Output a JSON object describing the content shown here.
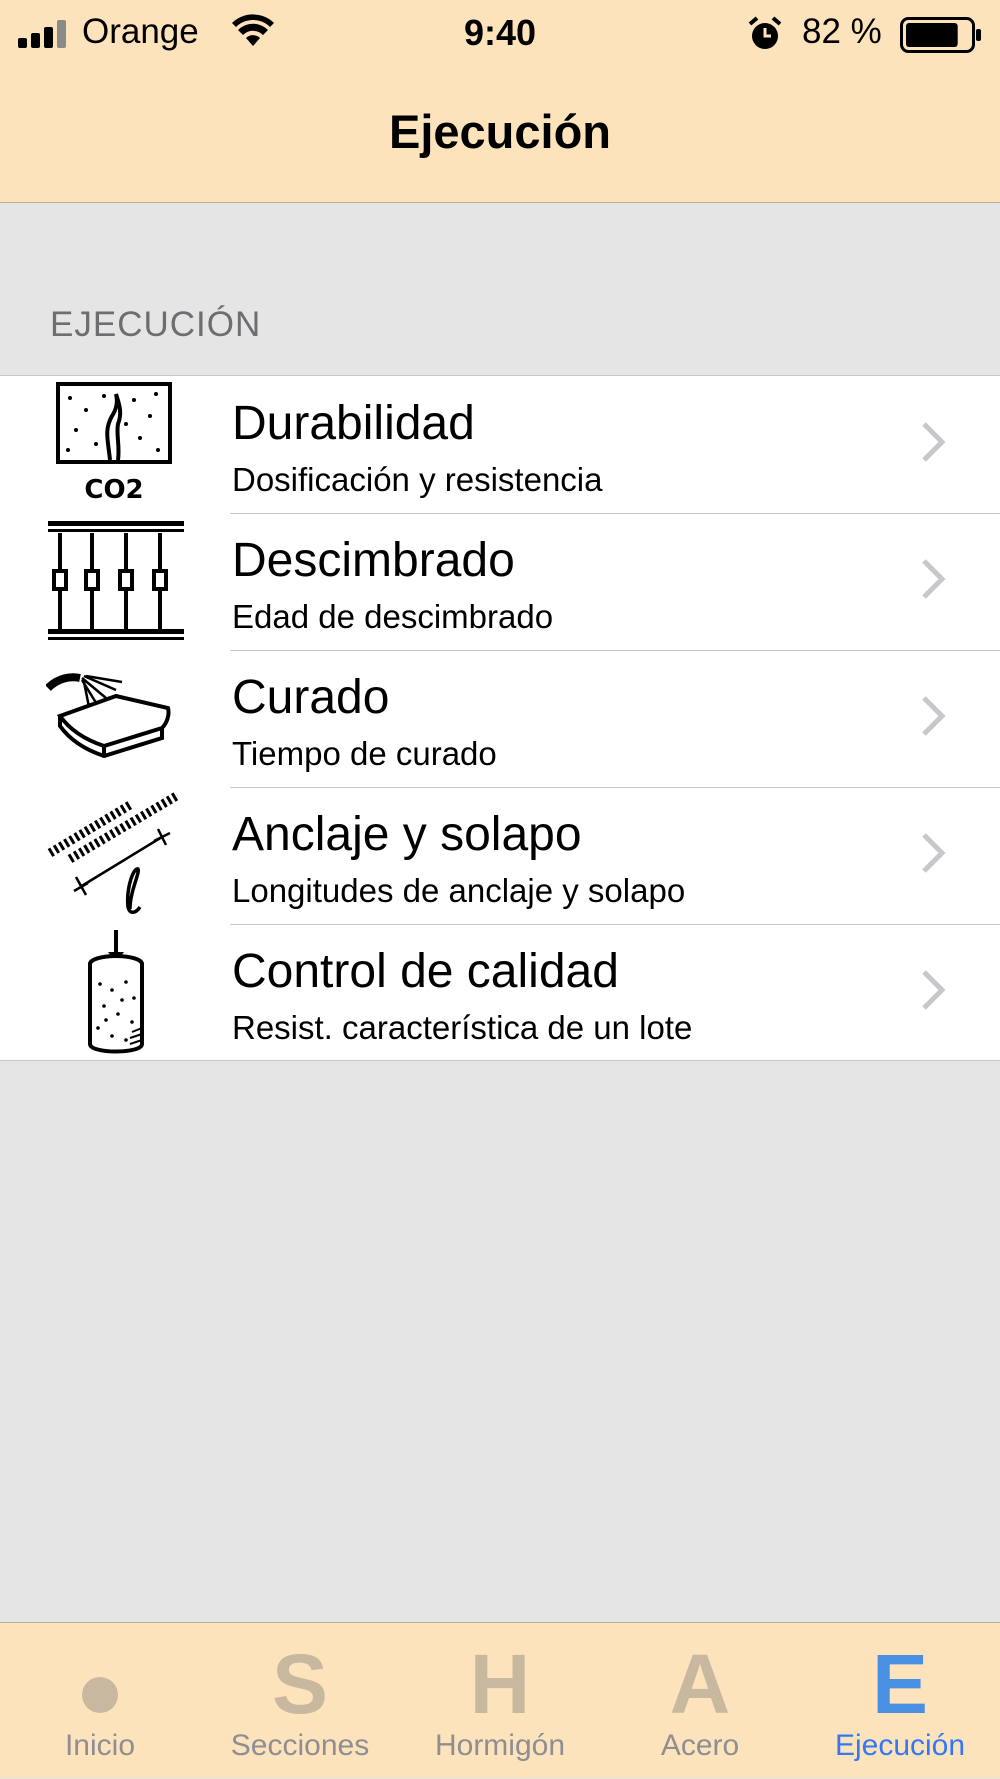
{
  "status_bar": {
    "carrier": "Orange",
    "time": "9:40",
    "battery_percent": "82 %",
    "battery_level": 0.82,
    "icons": [
      "signal-icon",
      "wifi-icon",
      "alarm-icon",
      "battery-icon"
    ]
  },
  "nav": {
    "title": "Ejecución"
  },
  "section": {
    "header": "EJECUCIÓN",
    "items": [
      {
        "title": "Durabilidad",
        "subtitle": "Dosificación y resistencia",
        "icon": "durability-icon",
        "icon_text": "CO2"
      },
      {
        "title": "Descimbrado",
        "subtitle": "Edad de descimbrado",
        "icon": "shoring-icon"
      },
      {
        "title": "Curado",
        "subtitle": "Tiempo de curado",
        "icon": "curing-icon"
      },
      {
        "title": "Anclaje y solapo",
        "subtitle": "Longitudes de anclaje y solapo",
        "icon": "anchorage-icon"
      },
      {
        "title": "Control de calidad",
        "subtitle": "Resist. característica de un lote",
        "icon": "quality-control-icon"
      }
    ]
  },
  "tabbar": {
    "active": "Ejecución",
    "tabs": [
      {
        "label": "Inicio",
        "glyph": ""
      },
      {
        "label": "Secciones",
        "glyph": "S"
      },
      {
        "label": "Hormigón",
        "glyph": "H"
      },
      {
        "label": "Acero",
        "glyph": "A"
      },
      {
        "label": "Ejecución",
        "glyph": "E"
      }
    ]
  },
  "colors": {
    "bar_background": "#fde3bb",
    "page_background": "#e5e5e5",
    "active_tab": "#3478f6",
    "inactive_glyph": "#c8b8a0"
  }
}
